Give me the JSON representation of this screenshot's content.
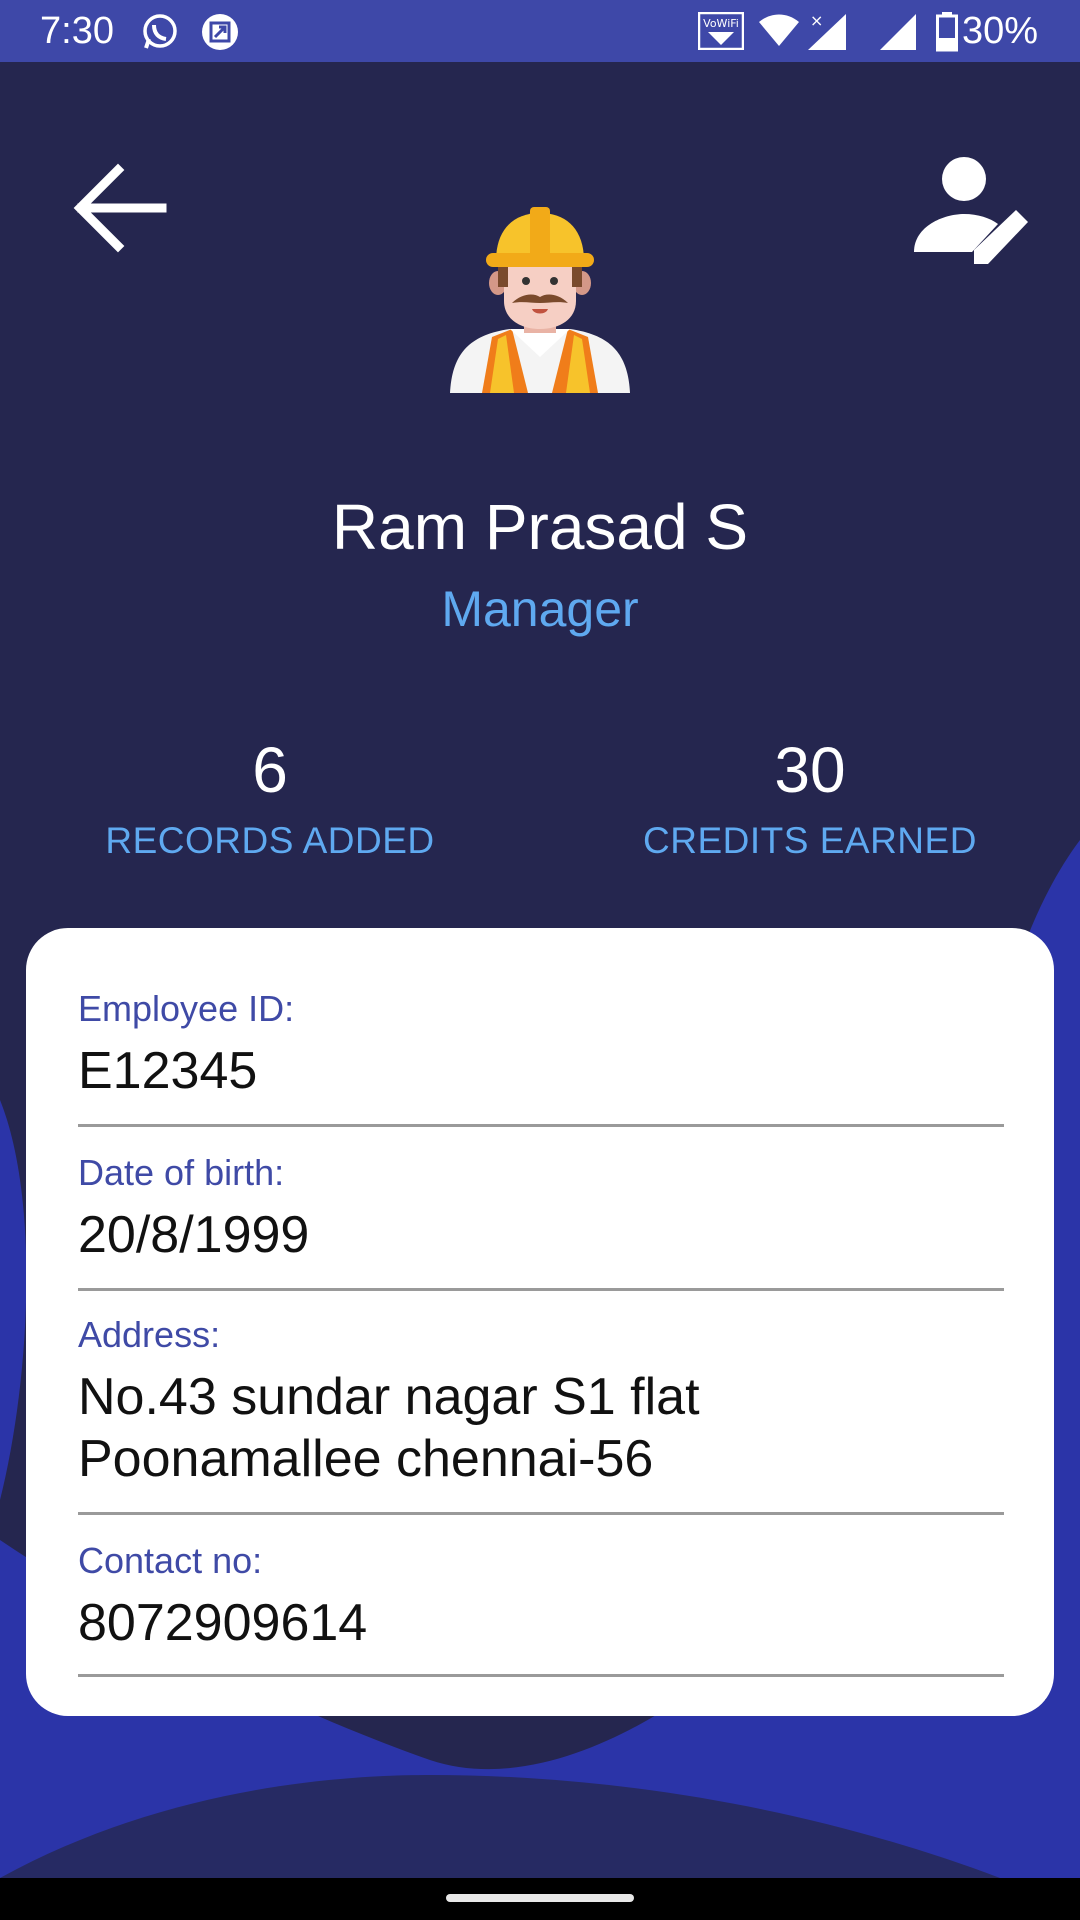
{
  "status_bar": {
    "time": "7:30",
    "battery": "30%",
    "icons": [
      "whatsapp-icon",
      "screenshot-icon",
      "vowifi-icon",
      "wifi-icon",
      "signal-icon",
      "signal-icon",
      "battery-icon"
    ]
  },
  "profile": {
    "name": "Ram Prasad S",
    "role": "Manager"
  },
  "stats": [
    {
      "value": "6",
      "label": "RECORDS ADDED"
    },
    {
      "value": "30",
      "label": "CREDITS EARNED"
    }
  ],
  "details": {
    "employee_id": {
      "label": "Employee ID:",
      "value": "E12345"
    },
    "dob": {
      "label": "Date of birth:",
      "value": "20/8/1999"
    },
    "address": {
      "label": "Address:",
      "value_line1": "No.43 sundar nagar S1 flat",
      "value_line2": "Poonamallee chennai-56"
    },
    "contact": {
      "label": "Contact no:",
      "value": "8072909614"
    }
  },
  "colors": {
    "background": "#25264f",
    "status_bar": "#3e48a8",
    "accent_blue": "#5fa9f0",
    "label_blue": "#3f4aa6",
    "wave_blue": "#2b34a8"
  }
}
